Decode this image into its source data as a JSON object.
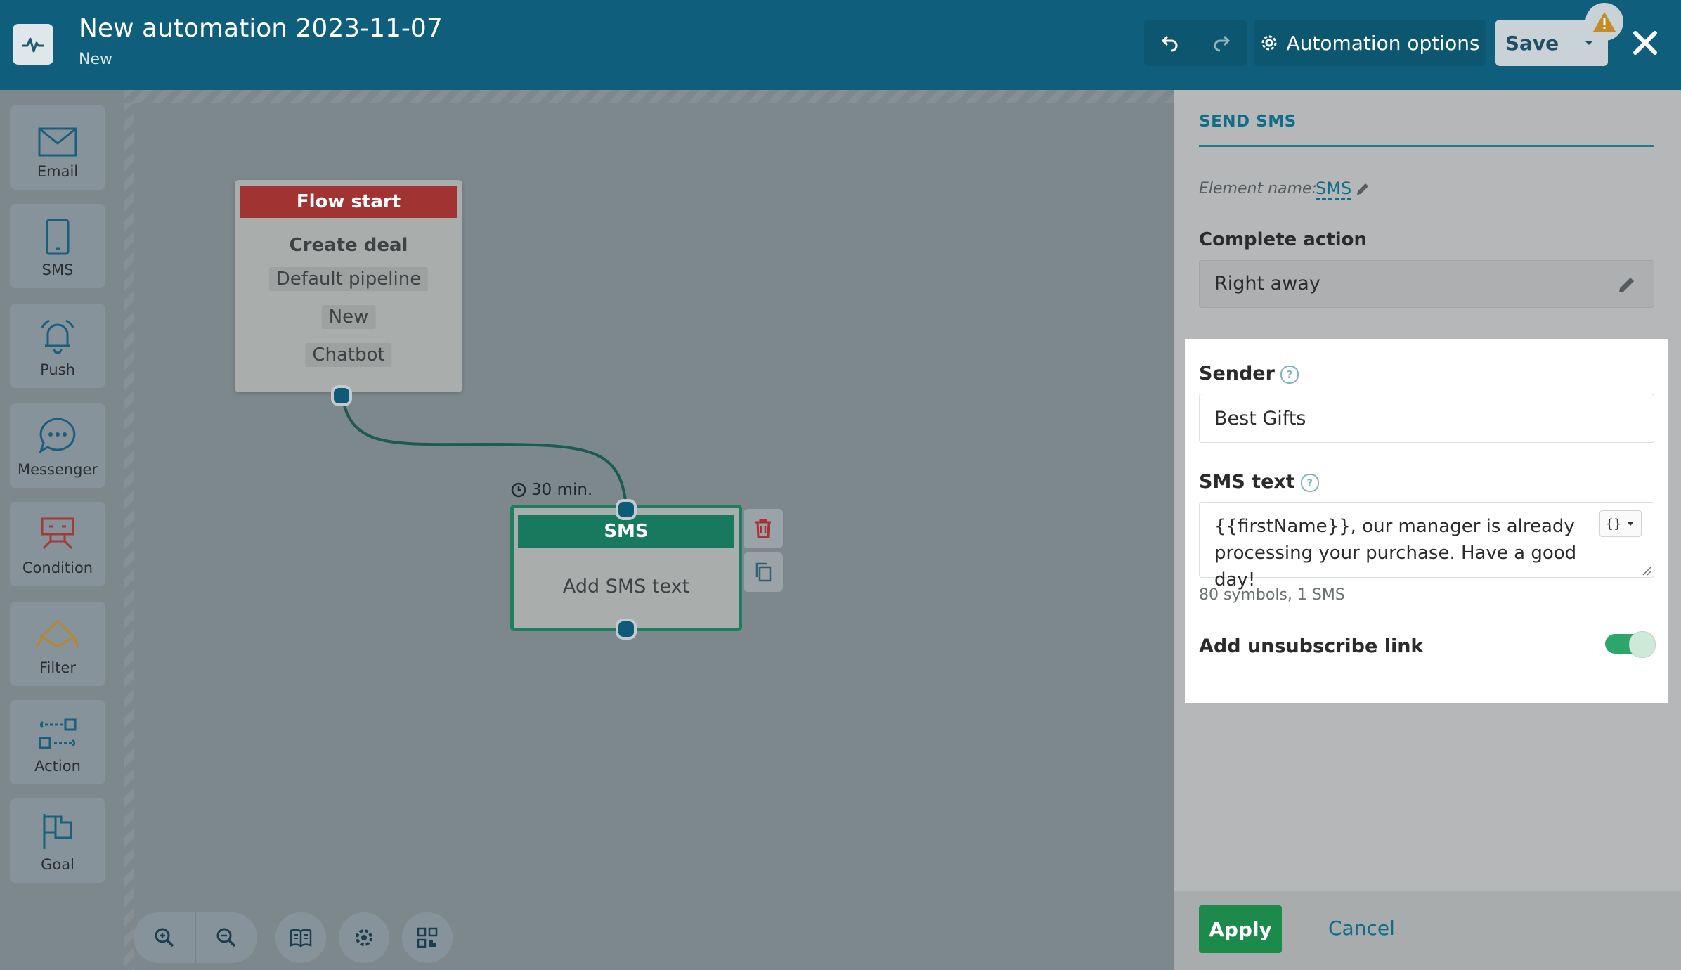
{
  "header": {
    "title": "New automation 2023-11-07",
    "status": "New",
    "options_label": "Automation options",
    "save_label": "Save"
  },
  "toolbar": {
    "items": [
      {
        "label": "Email",
        "icon": "envelope-icon"
      },
      {
        "label": "SMS",
        "icon": "phone-icon"
      },
      {
        "label": "Push",
        "icon": "bell-icon"
      },
      {
        "label": "Messenger",
        "icon": "chat-icon"
      },
      {
        "label": "Condition",
        "icon": "condition-icon"
      },
      {
        "label": "Filter",
        "icon": "filter-icon"
      },
      {
        "label": "Action",
        "icon": "action-icon"
      },
      {
        "label": "Goal",
        "icon": "flag-icon"
      }
    ]
  },
  "canvas": {
    "flow_start": {
      "header": "Flow start",
      "title": "Create deal",
      "chips": [
        "Default pipeline",
        "New",
        "Chatbot"
      ]
    },
    "sms_node": {
      "delay": "30 min.",
      "header": "SMS",
      "body": "Add SMS text"
    }
  },
  "panel": {
    "header": "SEND SMS",
    "element_name_label": "Element name:",
    "element_name_value": "SMS",
    "complete_action_label": "Complete action",
    "complete_action_value": "Right away",
    "sender_label": "Sender",
    "sender_value": "Best Gifts",
    "sms_text_label": "SMS text",
    "sms_text_value": "{{firstName}}, our manager is already processing your purchase. Have a good day!",
    "vars_button": "{}",
    "counter": "80 symbols, 1 SMS",
    "unsubscribe_label": "Add unsubscribe link",
    "unsubscribe_enabled": true,
    "apply_label": "Apply",
    "cancel_label": "Cancel"
  },
  "colors": {
    "header_bg": "#0f5f7c",
    "flow_start_red": "#a23333",
    "sms_green": "#177a5e",
    "apply_green": "#1c8a4b",
    "link_blue": "#0f6d8a"
  }
}
